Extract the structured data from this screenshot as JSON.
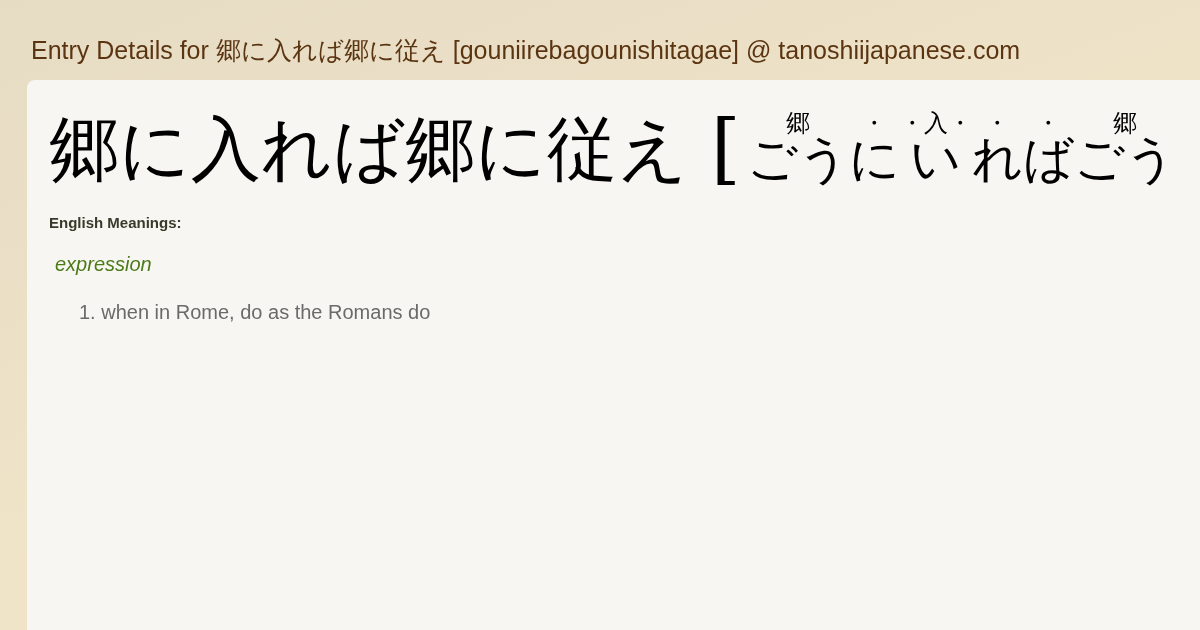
{
  "page_title": "Entry Details for 郷に入れば郷に従え [gouniirebagounishitagae] @ tanoshiijapanese.com",
  "entry": {
    "headword": "郷に入れば郷に従え",
    "bracket": "[",
    "reading": [
      {
        "text": "ごう",
        "ruby": "郷"
      },
      {
        "text": "に",
        "ruby": "・"
      },
      {
        "text": "い",
        "ruby": "・入・"
      },
      {
        "text": "れ",
        "ruby": "・"
      },
      {
        "text": "ば",
        "ruby": "・"
      },
      {
        "text": "ごう",
        "ruby": "郷"
      }
    ]
  },
  "meanings": {
    "heading": "English Meanings:",
    "part_of_speech": "expression",
    "senses": [
      {
        "number": "1.",
        "text": "when in Rome, do as the Romans do"
      }
    ]
  }
}
